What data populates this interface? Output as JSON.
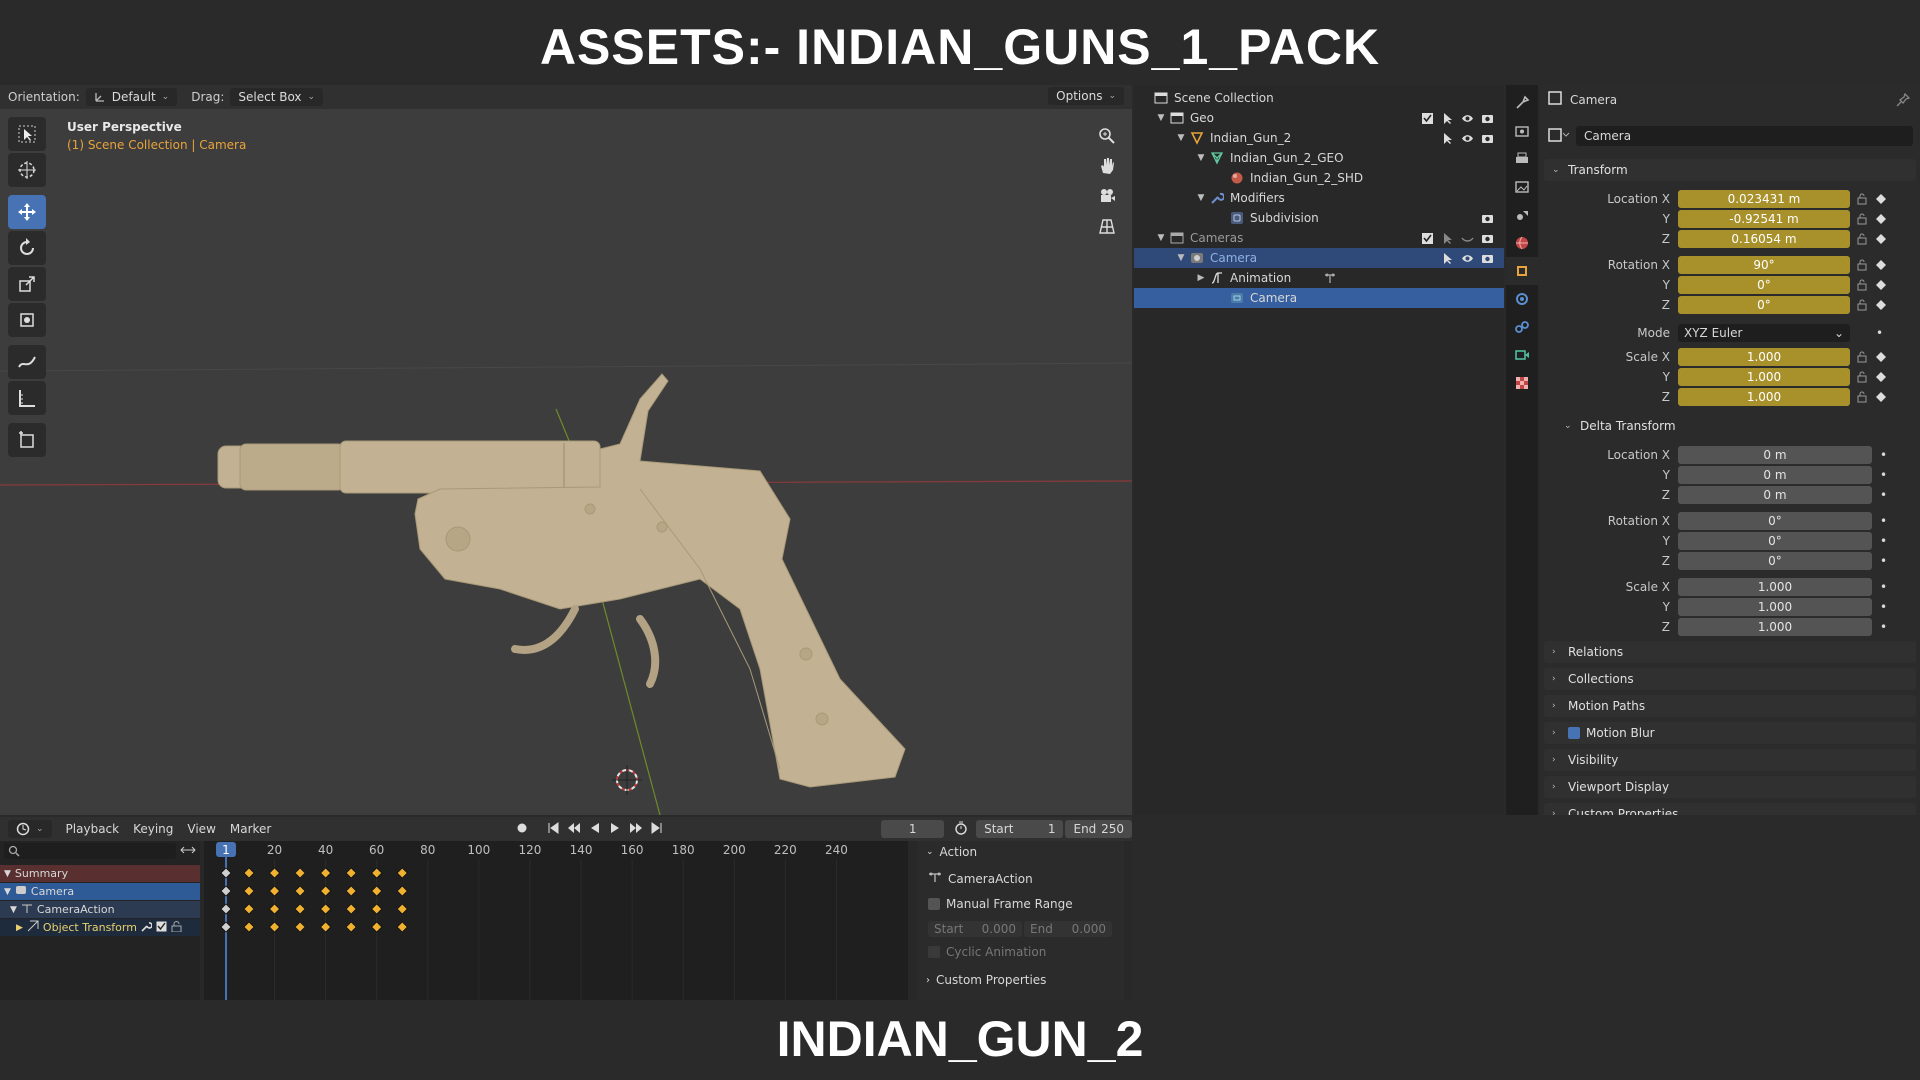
{
  "overlay": {
    "top_title": "ASSETS:- INDIAN_GUNS_1_PACK",
    "bottom_title": "INDIAN_GUN_2"
  },
  "viewport": {
    "orientation_label": "Orientation:",
    "orientation_value": "Default",
    "drag_label": "Drag:",
    "drag_value": "Select Box",
    "options_label": "Options",
    "perspective": "User Perspective",
    "context": "(1) Scene Collection | Camera"
  },
  "outliner": {
    "rows": [
      {
        "label": "Scene Collection"
      },
      {
        "label": "Geo"
      },
      {
        "label": "Indian_Gun_2"
      },
      {
        "label": "Indian_Gun_2_GEO"
      },
      {
        "label": "Indian_Gun_2_SHD"
      },
      {
        "label": "Modifiers"
      },
      {
        "label": "Subdivision"
      },
      {
        "label": "Cameras"
      },
      {
        "label": "Camera"
      },
      {
        "label": "Animation"
      },
      {
        "label": "Camera"
      }
    ]
  },
  "properties": {
    "header": "Camera",
    "name_field": "Camera",
    "transform": {
      "title": "Transform",
      "location": {
        "label": "Location X",
        "x": "0.023431 m",
        "y": "-0.92541 m",
        "z": "0.16054 m"
      },
      "rotation": {
        "label": "Rotation X",
        "x": "90°",
        "y": "0°",
        "z": "0°"
      },
      "mode_label": "Mode",
      "mode_value": "XYZ Euler",
      "scale": {
        "label": "Scale X",
        "x": "1.000",
        "y": "1.000",
        "z": "1.000"
      }
    },
    "delta": {
      "title": "Delta Transform",
      "location": {
        "label": "Location X",
        "x": "0 m",
        "y": "0 m",
        "z": "0 m"
      },
      "rotation": {
        "label": "Rotation X",
        "x": "0°",
        "y": "0°",
        "z": "0°"
      },
      "scale": {
        "label": "Scale X",
        "x": "1.000",
        "y": "1.000",
        "z": "1.000"
      }
    },
    "axis_y": "Y",
    "axis_z": "Z",
    "panels": [
      "Relations",
      "Collections",
      "Motion Paths",
      "Motion Blur",
      "Visibility",
      "Viewport Display",
      "Custom Properties"
    ]
  },
  "timeline": {
    "menu": [
      "Playback",
      "Keying",
      "View",
      "Marker"
    ],
    "current_frame": "1",
    "start_label": "Start",
    "start": "1",
    "end_label": "End",
    "end": "250",
    "ticks": [
      "1",
      "20",
      "40",
      "60",
      "80",
      "100",
      "120",
      "140",
      "160",
      "180",
      "200",
      "220",
      "240"
    ],
    "channels": [
      "Summary",
      "Camera",
      "CameraAction",
      "Object Transform"
    ],
    "keyframes": [
      1,
      10,
      20,
      30,
      40,
      50,
      60,
      70
    ]
  },
  "action": {
    "title": "Action",
    "name": "CameraAction",
    "manual_range": "Manual Frame Range",
    "start_label": "Start",
    "start": "0.000",
    "end_label": "End",
    "end": "0.000",
    "cyclic": "Cyclic Animation",
    "custom": "Custom Properties"
  },
  "colors": {
    "accent": "#4772b3",
    "animated": "#a8912a",
    "context": "#e8a33b",
    "gun": "#c2b293"
  }
}
